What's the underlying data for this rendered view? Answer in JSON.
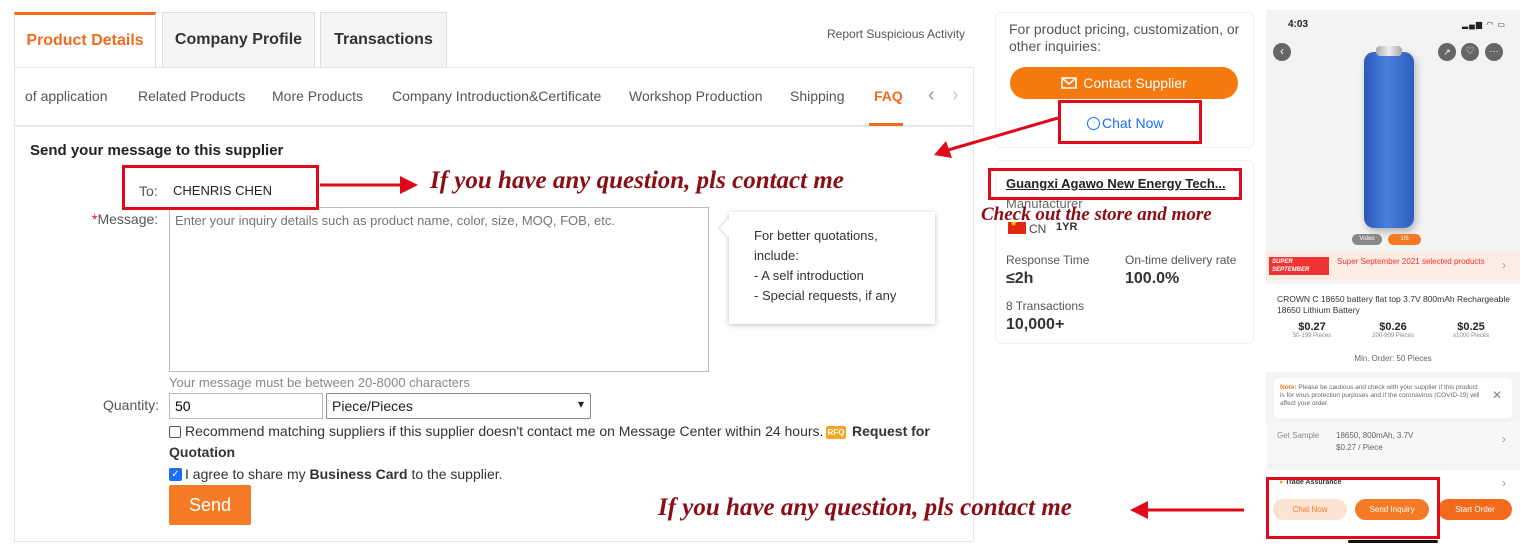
{
  "tabs": {
    "product_details": "Product Details",
    "company_profile": "Company Profile",
    "transactions": "Transactions",
    "report": "Report Suspicious Activity"
  },
  "subnav": [
    "of application",
    "Related Products",
    "More Products",
    "Company Introduction&Certificate",
    "Workshop Production",
    "Shipping",
    "FAQ"
  ],
  "form": {
    "title": "Send your message to this supplier",
    "to_label": "To:",
    "to_value": "CHENRIS CHEN",
    "message_label": "Message:",
    "message_placeholder": "Enter your inquiry details such as product name, color, size, MOQ, FOB, etc.",
    "tip_title": "For better quotations, include:",
    "tip_1": "- A self introduction",
    "tip_2": "- Special requests, if any",
    "char_hint": "Your message must be between 20-8000 characters",
    "quantity_label": "Quantity:",
    "quantity_value": "50",
    "unit_value": "Piece/Pieces",
    "recommend_text": "Recommend matching suppliers if this supplier doesn't contact me on Message Center within 24 hours.",
    "rfq_badge": "RFQ",
    "rfq_text_1": "Request for",
    "rfq_text_2": "Quotation",
    "agree_pre": "I agree to share my",
    "agree_bold": "Business Card",
    "agree_post": "to the supplier.",
    "send": "Send"
  },
  "supplier": {
    "inquiry_text": "For product pricing, customization, or other inquiries:",
    "contact_button": "Contact Supplier",
    "chat_now": "Chat Now",
    "company_name": "Guangxi Agawo New Energy Tech...",
    "company_type": "Manufacturer",
    "country": "CN",
    "years": "1YR",
    "response_label": "Response Time",
    "response_value": "≤2h",
    "ontime_label": "On-time delivery rate",
    "ontime_value": "100.0%",
    "transactions_label": "8 Transactions",
    "transactions_value": "10,000+"
  },
  "annotations": {
    "note_top": "If you have any question, pls contact me",
    "note_store": "Check out the store and more",
    "note_bottom": "If you have any question, pls contact me"
  },
  "phone": {
    "time": "4:03",
    "video": "Video",
    "image_count": "1/5",
    "promo_logo_1": "SUPER",
    "promo_logo_2": "SEPTEMBER",
    "promo_text": "Super September 2021 selected products",
    "product_title": "CROWN C 18650 battery flat top 3.7V 800mAh Rechargeable 18650 Lithium Battery",
    "prices": [
      {
        "price": "$0.27",
        "range": "50-199 Pieces"
      },
      {
        "price": "$0.26",
        "range": "200-999 Pieces"
      },
      {
        "price": "$0.25",
        "range": "≥1000 Pieces"
      }
    ],
    "min_order": "Min. Order: 50 Pieces",
    "note_label": "Note:",
    "note_text": "Please be cautious and check with your supplier if this product is for virus protection purposes and if the coronavirus (COVID-19) will affect your order.",
    "sample_label": "Get Sample",
    "sample_spec": "18650, 800mAh, 3.7V",
    "sample_price": "$0.27 / Piece",
    "trade_assurance": "Trade Assurance",
    "chat_now": "Chat Now",
    "send_inquiry": "Send Inquiry",
    "start_order": "Start Order"
  },
  "colors": {
    "accent": "#f26b1d",
    "annotation_red": "#e0091a",
    "note_text": "#8a0e16",
    "link_blue": "#1a6ef5"
  }
}
